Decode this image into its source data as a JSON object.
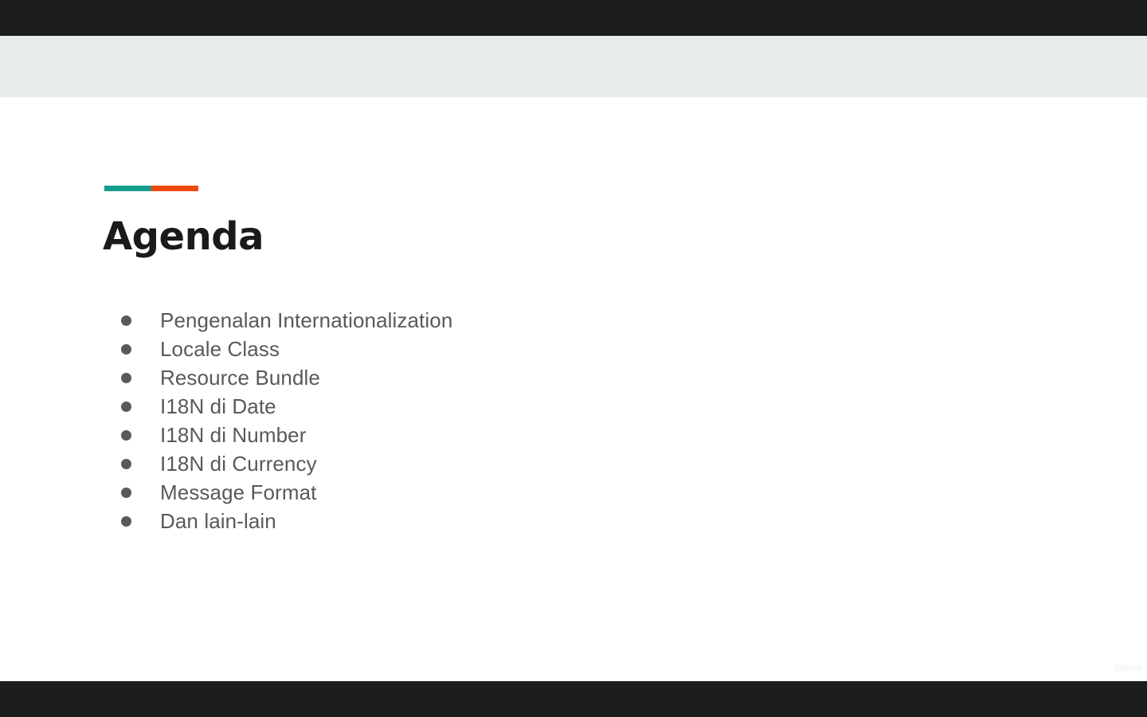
{
  "slide": {
    "title": "Agenda",
    "accent_colors": {
      "left": "#149e8e",
      "right": "#ee4a0f"
    },
    "items": [
      "Pengenalan Internationalization",
      "Locale Class",
      "Resource Bundle",
      "I18N di Date",
      "I18N di Number",
      "I18N di Currency",
      "Message Format",
      "Dan lain-lain"
    ]
  },
  "watermark": {
    "icon": "udemy-logo-icon",
    "text": "Udemy"
  }
}
